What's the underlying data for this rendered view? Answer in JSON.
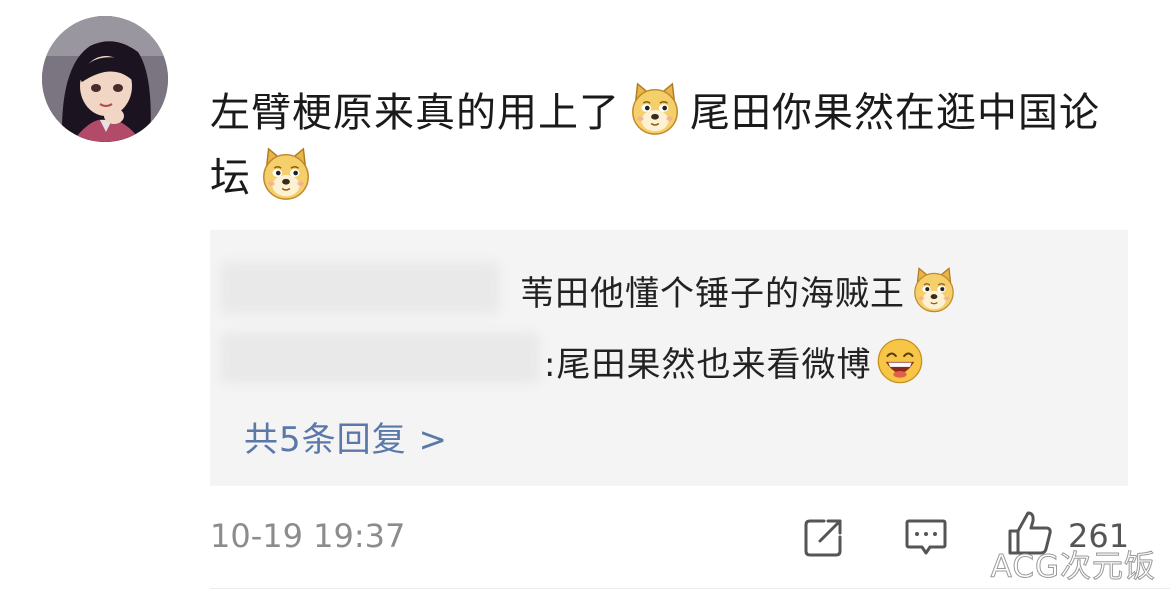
{
  "comment": {
    "avatar_icon": "anime-girl-avatar",
    "text_part1": "左臂梗原来真的用上了",
    "text_part2": "尾田你果然在逛中国论坛",
    "emoji": "doge-emoji"
  },
  "replies": [
    {
      "author": "",
      "separator": "",
      "text": "苇田他懂个锤子的海贼王",
      "emoji": "doge-emoji"
    },
    {
      "author": "",
      "separator": ":",
      "text": "尾田果然也来看微博",
      "emoji": "laughing-emoji"
    }
  ],
  "more_replies_label": "共5条回复 >",
  "footer": {
    "timestamp": "10-19 19:37",
    "share_icon": "share-icon",
    "comment_icon": "comment-icon",
    "like_icon": "thumbs-up-icon",
    "like_count": "261"
  },
  "watermark": "ACG次元饭"
}
